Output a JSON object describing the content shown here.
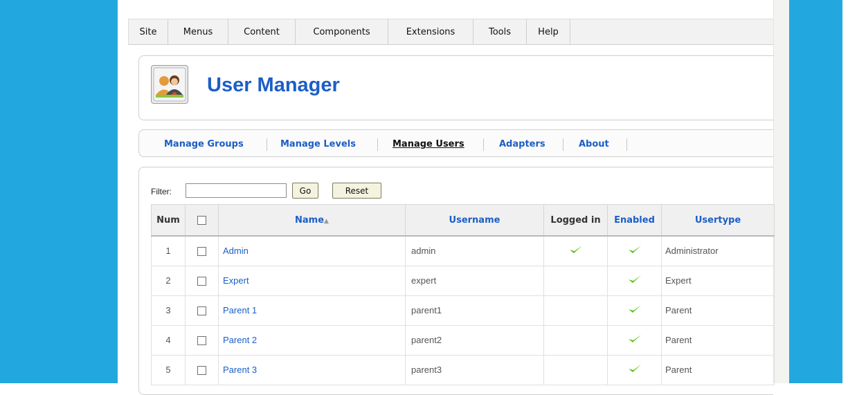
{
  "menubar": {
    "items": [
      "Site",
      "Menus",
      "Content",
      "Components",
      "Extensions",
      "Tools",
      "Help"
    ]
  },
  "header": {
    "title": "User Manager",
    "icon": "users-icon"
  },
  "tabs": [
    {
      "label": "Manage Groups",
      "active": false
    },
    {
      "label": "Manage Levels",
      "active": false
    },
    {
      "label": "Manage Users",
      "active": true
    },
    {
      "label": "Adapters",
      "active": false
    },
    {
      "label": "About",
      "active": false
    }
  ],
  "filter": {
    "label": "Filter:",
    "value": "",
    "go_label": "Go",
    "reset_label": "Reset"
  },
  "table": {
    "columns": {
      "num": "Num",
      "name": "Name",
      "username": "Username",
      "logged_in": "Logged in",
      "enabled": "Enabled",
      "usertype": "Usertype"
    },
    "sort_column": "name",
    "rows": [
      {
        "num": "1",
        "name": "Admin",
        "username": "admin",
        "logged_in": true,
        "enabled": true,
        "usertype": "Administrator"
      },
      {
        "num": "2",
        "name": "Expert",
        "username": "expert",
        "logged_in": false,
        "enabled": true,
        "usertype": "Expert"
      },
      {
        "num": "3",
        "name": "Parent 1",
        "username": "parent1",
        "logged_in": false,
        "enabled": true,
        "usertype": "Parent"
      },
      {
        "num": "4",
        "name": "Parent 2",
        "username": "parent2",
        "logged_in": false,
        "enabled": true,
        "usertype": "Parent"
      },
      {
        "num": "5",
        "name": "Parent 3",
        "username": "parent3",
        "logged_in": false,
        "enabled": true,
        "usertype": "Parent"
      }
    ]
  },
  "colors": {
    "link": "#1b5ec7",
    "page_background": "#22a8de",
    "check": "#5cbf1c"
  }
}
